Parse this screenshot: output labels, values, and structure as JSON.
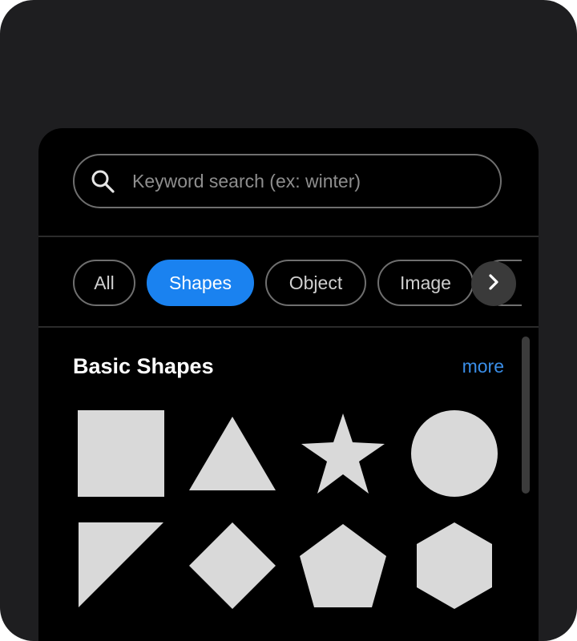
{
  "search": {
    "placeholder": "Keyword search (ex: winter)",
    "value": ""
  },
  "tabs": [
    {
      "label": "All",
      "active": false
    },
    {
      "label": "Shapes",
      "active": true
    },
    {
      "label": "Object",
      "active": false
    },
    {
      "label": "Image",
      "active": false
    }
  ],
  "section": {
    "title": "Basic Shapes",
    "more_label": "more"
  },
  "shapes": [
    {
      "name": "square"
    },
    {
      "name": "triangle"
    },
    {
      "name": "star"
    },
    {
      "name": "circle"
    },
    {
      "name": "right-triangle"
    },
    {
      "name": "diamond"
    },
    {
      "name": "pentagon"
    },
    {
      "name": "hexagon"
    }
  ],
  "colors": {
    "accent": "#1a82f0",
    "link": "#3a8ee8",
    "shape_fill": "#d9d9d9",
    "panel_bg": "#000000",
    "device_bg": "#1e1e20"
  },
  "icons": {
    "search": "search-icon",
    "next": "chevron-right-icon"
  }
}
